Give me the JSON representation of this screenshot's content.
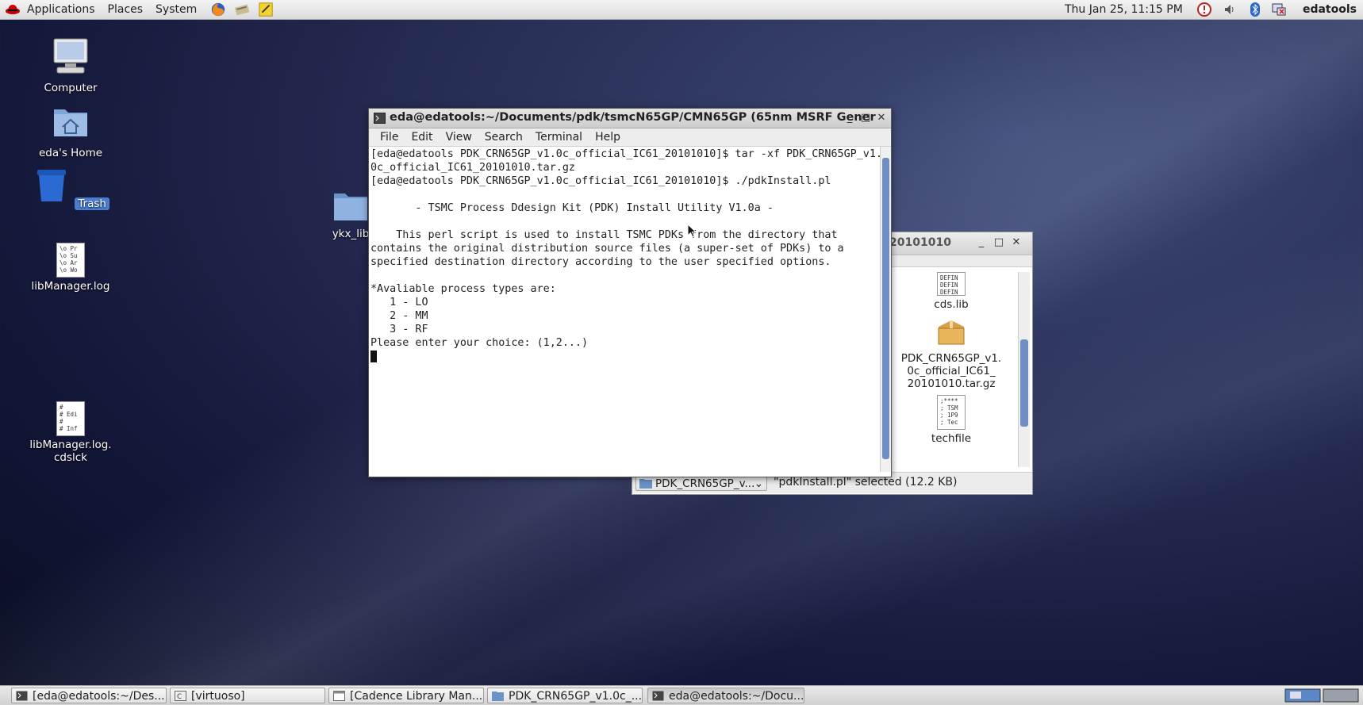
{
  "top_panel": {
    "menus": [
      "Applications",
      "Places",
      "System"
    ],
    "clock": "Thu Jan 25, 11:15 PM",
    "user": "edatools"
  },
  "desktop_icons": {
    "computer": "Computer",
    "home": "eda's Home",
    "trash": "Trash",
    "folder": "ykx_lib",
    "libmanager_log": "libManager.log",
    "libmanager_log_thumb": "\\o Pr\n\\o Su\n\\o Ar\n\\o Wo",
    "cdslck_label_1": "libManager.log.",
    "cdslck_label_2": "cdslck",
    "cdslck_thumb": "#\n# Edi\n#\n# Inf"
  },
  "file_manager": {
    "title_fragment": "20101010",
    "files": {
      "cds_lib": "cds.lib",
      "cds_lib_thumb": "DEFIN\nDEFIN\nDEFIN",
      "tarball_1": "PDK_CRN65GP_v1.",
      "tarball_2": "0c_official_IC61_",
      "tarball_3": "20101010.tar.gz",
      "techfile": "techfile",
      "techfile_thumb": ";****\n; TSM\n; 1P9\n; Tec"
    },
    "location": "PDK_CRN65GP_v...",
    "status": "\"pdkInstall.pl\" selected (12.2 KB)"
  },
  "terminal": {
    "title": "eda@edatools:~/Documents/pdk/tsmcN65GP/CMN65GP (65nm MSRF Gener",
    "menu": [
      "File",
      "Edit",
      "View",
      "Search",
      "Terminal",
      "Help"
    ],
    "lines": [
      "[eda@edatools PDK_CRN65GP_v1.0c_official_IC61_20101010]$ tar -xf PDK_CRN65GP_v1.",
      "0c_official_IC61_20101010.tar.gz",
      "[eda@edatools PDK_CRN65GP_v1.0c_official_IC61_20101010]$ ./pdkInstall.pl",
      "",
      "       - TSMC Process Ddesign Kit (PDK) Install Utility V1.0a -",
      "",
      "    This perl script is used to install TSMC PDKs from the directory that",
      "contains the original distribution source files (a super-set of PDKs) to a",
      "specified destination directory according to the user specified options.",
      "",
      "*Avaliable process types are:",
      "   1 - LO",
      "   2 - MM",
      "   3 - RF",
      "Please enter your choice: (1,2...)"
    ]
  },
  "taskbar": {
    "tasks": [
      "[eda@edatools:~/Des...",
      "[virtuoso]",
      "[Cadence Library Man...",
      "PDK_CRN65GP_v1.0c_...",
      "eda@edatools:~/Docu..."
    ]
  }
}
